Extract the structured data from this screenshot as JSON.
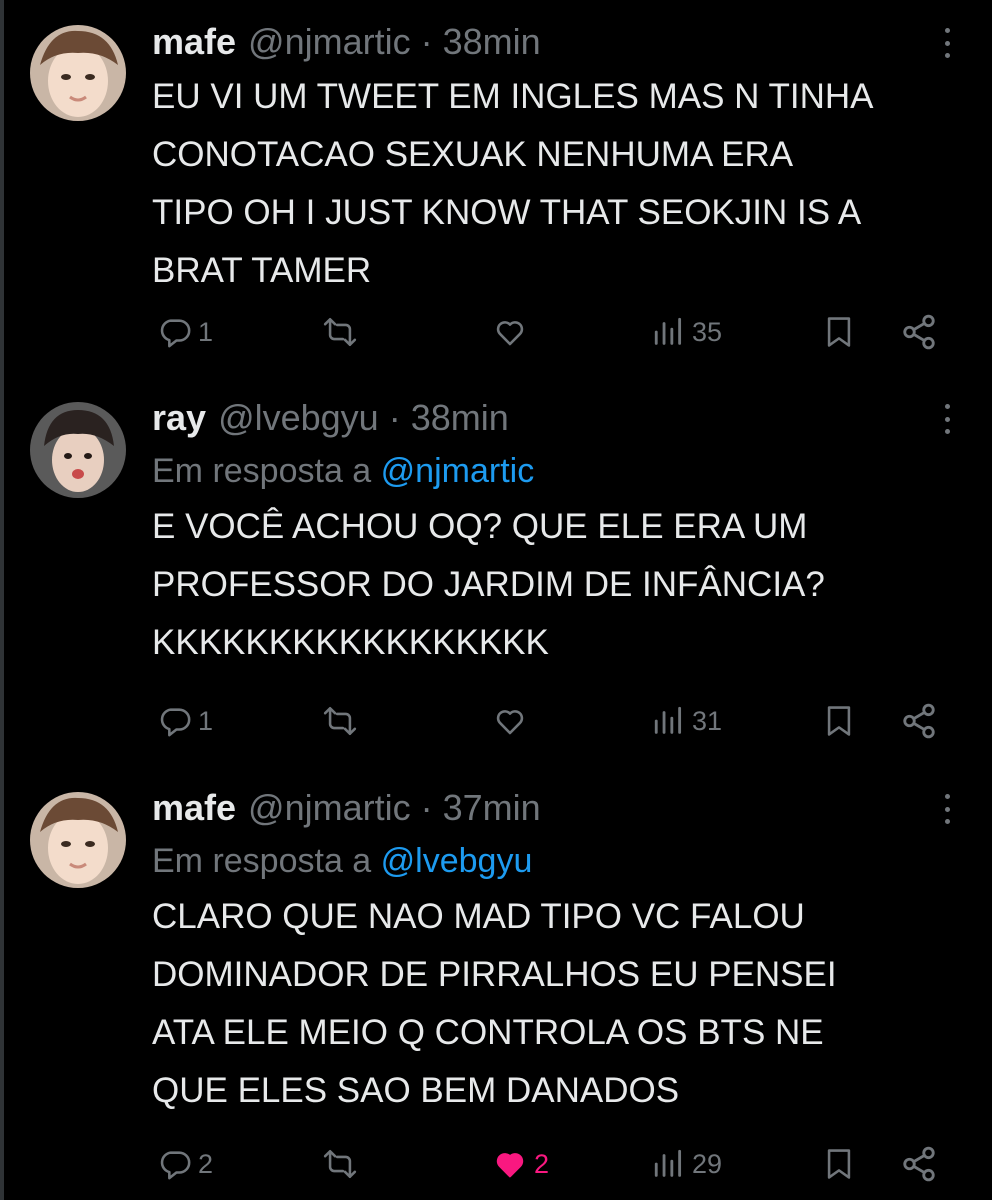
{
  "tweets": [
    {
      "name": "mafe",
      "handle": "@njmartic",
      "time": "38min",
      "reply_prefix": "",
      "reply_to": "",
      "text_lines": [
        "EU VI UM TWEET EM INGLES MAS N TINHA",
        "CONOTACAO SEXUAK NENHUMA ERA",
        "TIPO OH I JUST KNOW THAT SEOKJIN IS A",
        "BRAT TAMER"
      ],
      "replies": "1",
      "retweets": "",
      "likes": "",
      "liked": false,
      "views": "35"
    },
    {
      "name": "ray",
      "handle": "@lvebgyu",
      "time": "38min",
      "reply_prefix": "Em resposta a",
      "reply_to": "@njmartic",
      "text_lines": [
        "E VOCÊ ACHOU OQ? QUE ELE ERA UM",
        "PROFESSOR DO JARDIM DE INFÂNCIA?",
        "KKKKKKKKKKKKKKKKK"
      ],
      "replies": "1",
      "retweets": "",
      "likes": "",
      "liked": false,
      "views": "31"
    },
    {
      "name": "mafe",
      "handle": "@njmartic",
      "time": "37min",
      "reply_prefix": "Em resposta a",
      "reply_to": "@lvebgyu",
      "text_lines": [
        "CLARO QUE NAO MAD TIPO VC FALOU",
        "DOMINADOR DE PIRRALHOS EU PENSEI",
        "ATA ELE MEIO Q CONTROLA OS BTS NE",
        "QUE ELES SAO BEM DANADOS"
      ],
      "replies": "2",
      "retweets": "",
      "likes": "2",
      "liked": true,
      "views": "29"
    }
  ],
  "icons": {
    "reply": "reply-icon",
    "retweet": "retweet-icon",
    "like": "heart-icon",
    "views": "views-icon",
    "bookmark": "bookmark-icon",
    "share": "share-icon",
    "more": "more-icon"
  },
  "colors": {
    "background": "#000000",
    "text": "#e7e9ea",
    "muted": "#71767b",
    "mention": "#1d9bf0",
    "like": "#f91880"
  }
}
